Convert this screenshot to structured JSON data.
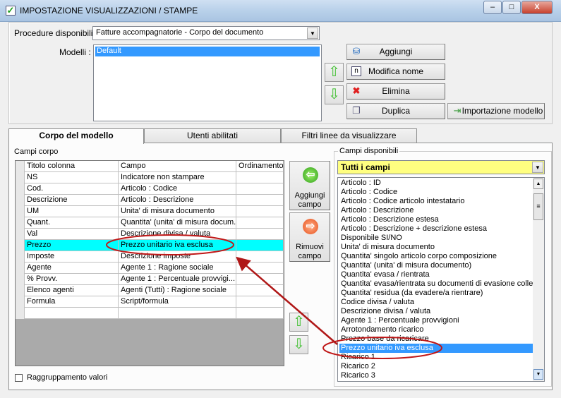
{
  "window": {
    "title": "IMPOSTAZIONE VISUALIZZAZIONI / STAMPE",
    "minimize": "–",
    "maximize": "□",
    "close": "X"
  },
  "top": {
    "procedure_label": "Procedure disponibili :",
    "procedure_value": "Fatture accompagnatorie - Corpo del documento",
    "modelli_label": "Modelli :",
    "modelli": [
      "Default"
    ],
    "buttons": {
      "aggiungi": "Aggiungi",
      "modifica": "Modifica nome",
      "elimina": "Elimina",
      "duplica": "Duplica",
      "importazione": "Importazione modello"
    }
  },
  "tabs": [
    {
      "label": "Corpo del modello",
      "active": true
    },
    {
      "label": "Utenti abilitati"
    },
    {
      "label": "Filtri linee da visualizzare"
    }
  ],
  "campi_corpo": {
    "label": "Campi corpo",
    "headers": [
      "Titolo colonna",
      "Campo",
      "Ordinamento"
    ],
    "rows": [
      [
        "NS",
        "Indicatore non stampare",
        ""
      ],
      [
        "Cod.",
        "Articolo : Codice",
        ""
      ],
      [
        "Descrizione",
        "Articolo : Descrizione",
        ""
      ],
      [
        "UM",
        "Unita' di misura documento",
        ""
      ],
      [
        "Quant.",
        "Quantita' (unita' di misura docum...",
        ""
      ],
      [
        "Val",
        "Descrizione divisa / valuta",
        ""
      ],
      [
        "Prezzo",
        "Prezzo unitario iva esclusa",
        ""
      ],
      [
        "Imposte",
        "Descrizione imposte",
        ""
      ],
      [
        "Agente",
        "Agente 1 : Ragione sociale",
        ""
      ],
      [
        "% Provv.",
        "Agente 1 : Percentuale provvigi...",
        ""
      ],
      [
        "Elenco agenti",
        "Agenti (Tutti) : Ragione sociale",
        ""
      ],
      [
        "Formula",
        "Script/formula",
        ""
      ],
      [
        "",
        "",
        ""
      ]
    ],
    "selected_row": 6
  },
  "actions": {
    "aggiungi_campo": "Aggiungi campo",
    "rimuovi_campo": "Rimuovi campo"
  },
  "raggruppamento": {
    "label": "Raggruppamento valori",
    "checked": false
  },
  "campi_disponibili": {
    "label": "Campi disponibili",
    "filter": "Tutti i campi",
    "filter_color": "#ffff80",
    "items": [
      "Articolo : ID",
      "Articolo : Codice",
      "Articolo : Codice articolo intestatario",
      "Articolo : Descrizione",
      "Articolo : Descrizione estesa",
      "Articolo : Descrizione + descrizione estesa",
      "Disponibile SI/NO",
      "Unita' di misura documento",
      "Quantita' singolo articolo corpo composizione",
      "Quantita' (unita' di misura documento)",
      "Quantita' evasa / rientrata",
      "Quantita' evasa/rientrata su documenti di evasione colleg",
      "Quantita' residua (da evadere/a rientrare)",
      "Codice divisa / valuta",
      "Descrizione divisa / valuta",
      "Agente 1 : Percentuale provvigioni",
      "Arrotondamento ricarico",
      "Prezzo base da ricaricare",
      "Prezzo unitario iva esclusa",
      "Ricarico 1",
      "Ricarico 2",
      "Ricarico 3"
    ],
    "selected_index": 18
  }
}
